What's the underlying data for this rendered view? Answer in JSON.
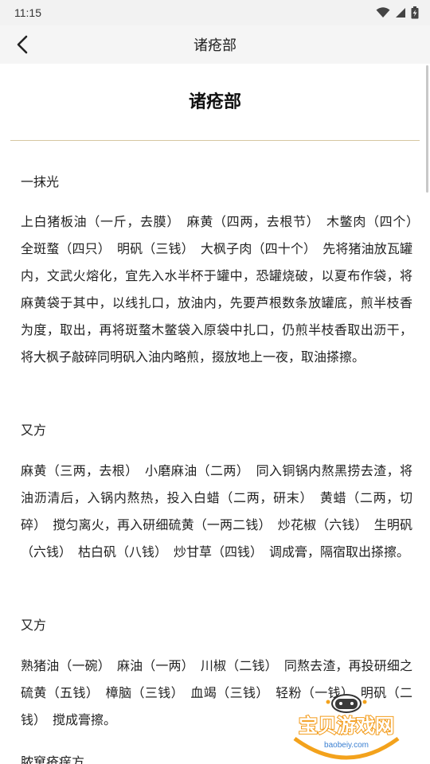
{
  "status_bar": {
    "time": "11:15"
  },
  "app_bar": {
    "title": "诸疮部"
  },
  "article": {
    "title": "诸疮部",
    "sections": [
      {
        "heading": "一抹光",
        "text": "上白猪板油（一斤，去膜）　麻黄（四两，去根节）　木鳖肉（四个）　全斑蝥（四只）　明矾（三钱）　大枫子肉（四十个）　先将猪油放瓦罐内，文武火熔化，宜先入水半杯于罐中，恐罐烧破，以夏布作袋，将麻黄袋于其中，以线扎口，放油内，先要芦根数条放罐底，煎半枝香为度，取出，再将斑蝥木鳖袋入原袋中扎口，仍煎半枝香取出沥干，将大枫子敲碎同明矾入油内略煎，掇放地上一夜，取油搽擦。"
      },
      {
        "heading": "又方",
        "text": "麻黄（三两，去根）　小磨麻油（二两）　同入铜锅内熬黑捞去渣，将油沥清后，入锅内熬热，投入白蜡（二两，研末）　黄蜡（二两，切碎）　搅匀离火，再入研细硫黄（一两二钱）　炒花椒（六钱）　生明矾（六钱）　枯白矾（八钱）　炒甘草（四钱）　调成膏，隔宿取出搽擦。"
      },
      {
        "heading": "又方",
        "text": "熟猪油（一碗）　麻油（一两）　川椒（二钱）　同熬去渣，再投研细之硫黄（五钱）　樟脑（三钱）　血竭（三钱）　轻粉（一钱）　明矾（二钱）　搅成膏擦。"
      },
      {
        "heading": "脓窠疮痒方"
      }
    ]
  },
  "watermark": {
    "text": "宝贝游戏网",
    "url": "baobeiy.com"
  },
  "colors": {
    "divider": "#d6c7a1",
    "status_bg": "#f2f2f2",
    "appbar_bg": "#f5f5f5"
  }
}
